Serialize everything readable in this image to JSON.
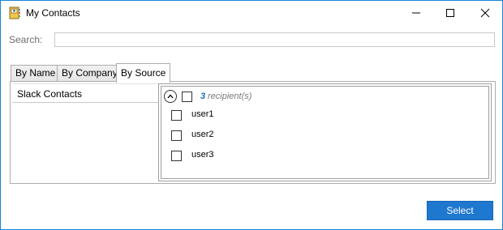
{
  "window": {
    "title": "My Contacts",
    "app_icon": "contacts-book-icon"
  },
  "search": {
    "label": "Search:",
    "value": "",
    "placeholder": ""
  },
  "tabs": [
    {
      "label": "By Name",
      "selected": false
    },
    {
      "label": "By Company",
      "selected": false
    },
    {
      "label": "By Source",
      "selected": true
    }
  ],
  "sources": [
    {
      "label": "Slack Contacts"
    }
  ],
  "recipients": {
    "count": "3",
    "count_label": "recipient(s)",
    "users": [
      {
        "label": "user1",
        "checked": false
      },
      {
        "label": "user2",
        "checked": false
      },
      {
        "label": "user3",
        "checked": false
      }
    ]
  },
  "actions": {
    "select_label": "Select"
  },
  "colors": {
    "accent": "#1e78d0",
    "window_border": "#1883d7",
    "count_color": "#1f6fbf"
  }
}
